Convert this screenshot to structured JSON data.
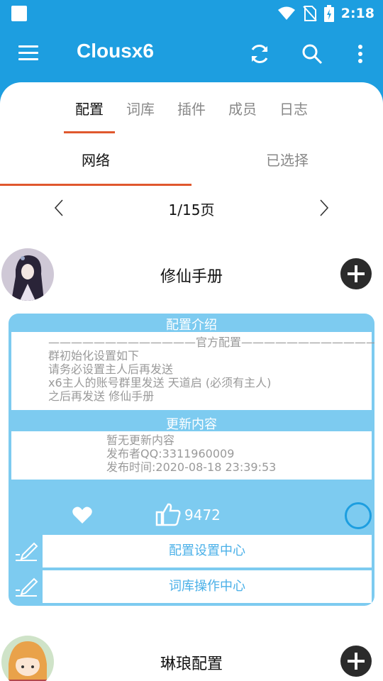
{
  "status": {
    "time": "2:18"
  },
  "app": {
    "title": "Clousx6"
  },
  "tabs": [
    {
      "label": "配置"
    },
    {
      "label": "词库"
    },
    {
      "label": "插件"
    },
    {
      "label": "成员"
    },
    {
      "label": "日志"
    }
  ],
  "active_tab": "配置",
  "subtabs": [
    {
      "label": "网络"
    },
    {
      "label": "已选择"
    }
  ],
  "active_subtab": "网络",
  "pager": {
    "text": "1/15页"
  },
  "items": [
    {
      "name": "修仙手册",
      "intro_title": "配置介绍",
      "intro_lines": [
        "—————————————官方配置—————————————",
        "群初始化设置如下",
        "请务必设置主人后再发送",
        "x6主人的账号群里发送 天道启 (必须有主人)",
        "之后再发送 修仙手册"
      ],
      "update_title": "更新内容",
      "update_lines": [
        "暂无更新内容",
        "发布者QQ:3311960009",
        "发布时间:2020-08-18 23:39:53"
      ],
      "likes": "9472",
      "link1": "配置设置中心",
      "link2": "词库操作中心"
    },
    {
      "name": "琳琅配置"
    }
  ],
  "colors": {
    "primary": "#1d9ee0",
    "card": "#7dcbf0",
    "accent": "#e0582e"
  }
}
